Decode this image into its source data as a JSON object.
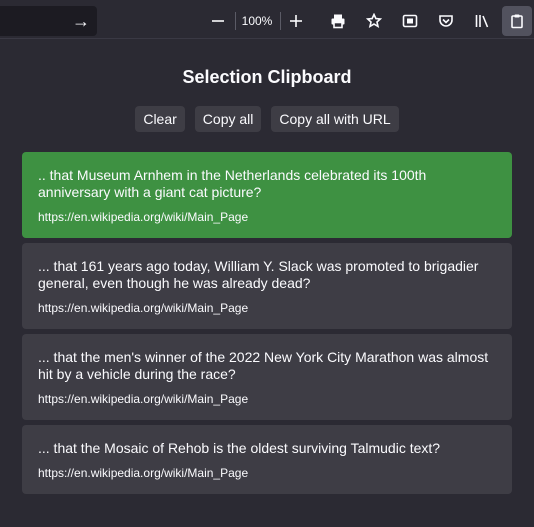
{
  "toolbar": {
    "zoom_out_symbol": "—",
    "zoom_level": "100%",
    "zoom_in_symbol": "+",
    "icons": [
      "go-arrow-icon",
      "zoom-out-icon",
      "zoom-in-icon",
      "print-icon",
      "bookmark-star-icon",
      "screenshot-icon",
      "pocket-icon",
      "library-icon",
      "clipboard-icon"
    ]
  },
  "popup": {
    "title": "Selection Clipboard",
    "buttons": {
      "clear": "Clear",
      "copy_all": "Copy all",
      "copy_all_url": "Copy all with URL"
    },
    "clips": [
      {
        "text": ".. that Museum Arnhem in the Netherlands celebrated its 100th anniversary with a giant cat picture?",
        "url": "https://en.wikipedia.org/wiki/Main_Page",
        "selected": true
      },
      {
        "text": "... that 161 years ago today, William Y. Slack was promoted to brigadier general, even though he was already dead?",
        "url": "https://en.wikipedia.org/wiki/Main_Page",
        "selected": false
      },
      {
        "text": "... that the men's winner of the 2022 New York City Marathon was almost hit by a vehicle during the race?",
        "url": "https://en.wikipedia.org/wiki/Main_Page",
        "selected": false
      },
      {
        "text": "... that the Mosaic of Rehob is the oldest surviving Talmudic text?",
        "url": "https://en.wikipedia.org/wiki/Main_Page",
        "selected": false
      }
    ]
  },
  "colors": {
    "selected_clip": "#3e9142",
    "clip_bg": "#3e3d45",
    "popup_bg": "#2b2a33"
  }
}
